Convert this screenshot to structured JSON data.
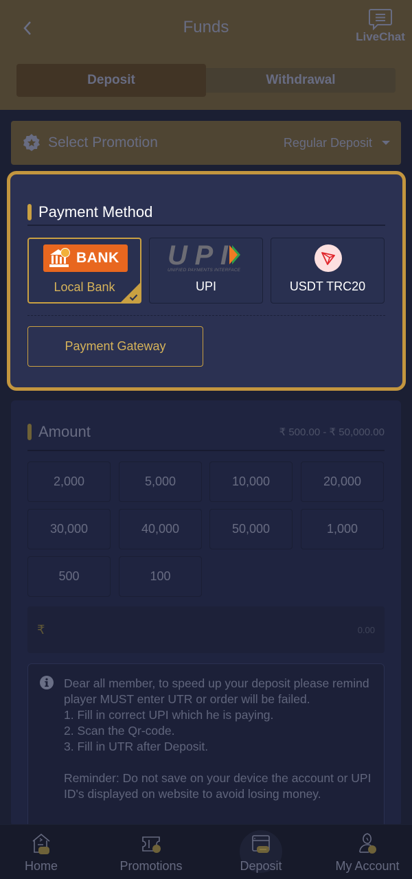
{
  "header": {
    "title": "Funds",
    "back_icon": "chevron-left-icon",
    "livechat_label": "LiveChat"
  },
  "tabs": [
    {
      "label": "Deposit",
      "active": true
    },
    {
      "label": "Withdrawal",
      "active": false
    }
  ],
  "promotion": {
    "label": "Select Promotion",
    "value": "Regular Deposit"
  },
  "payment_method": {
    "title": "Payment Method",
    "methods": [
      {
        "label": "Local Bank",
        "logo_text": "BANK",
        "selected": true
      },
      {
        "label": "UPI",
        "logo_text": "UPI",
        "logo_subtext": "UNIFIED PAYMENTS INTERFACE",
        "selected": false
      },
      {
        "label": "USDT TRC20",
        "selected": false
      }
    ],
    "gateway_label": "Payment Gateway"
  },
  "amount": {
    "title": "Amount",
    "range": "₹ 500.00 - ₹ 50,000.00",
    "chips": [
      "2,000",
      "5,000",
      "10,000",
      "20,000",
      "30,000",
      "40,000",
      "50,000",
      "1,000",
      "500",
      "100"
    ],
    "currency_symbol": "₹",
    "input_placeholder": "0.00"
  },
  "notice": {
    "text": "Dear all member, to speed up your deposit please remind player MUST enter UTR or order will be failed.\n1. Fill in correct UPI which he is paying.\n2. Scan the Qr-code.\n3. Fill in UTR after Deposit.\n\nReminder: Do not save on your device the account or UPI ID's displayed on website to avoid losing money."
  },
  "nav": [
    {
      "label": "Home",
      "icon": "home-icon",
      "active": false
    },
    {
      "label": "Promotions",
      "icon": "ticket-icon",
      "active": false
    },
    {
      "label": "Deposit",
      "icon": "wallet-card-icon",
      "active": true
    },
    {
      "label": "My Account",
      "icon": "user-icon",
      "active": false
    }
  ],
  "colors": {
    "accent_gold": "#c9a042",
    "card_bg": "#2b3152",
    "page_bg": "#1b1f33",
    "bank_orange": "#e8671f",
    "tron_red": "#e0262b"
  }
}
